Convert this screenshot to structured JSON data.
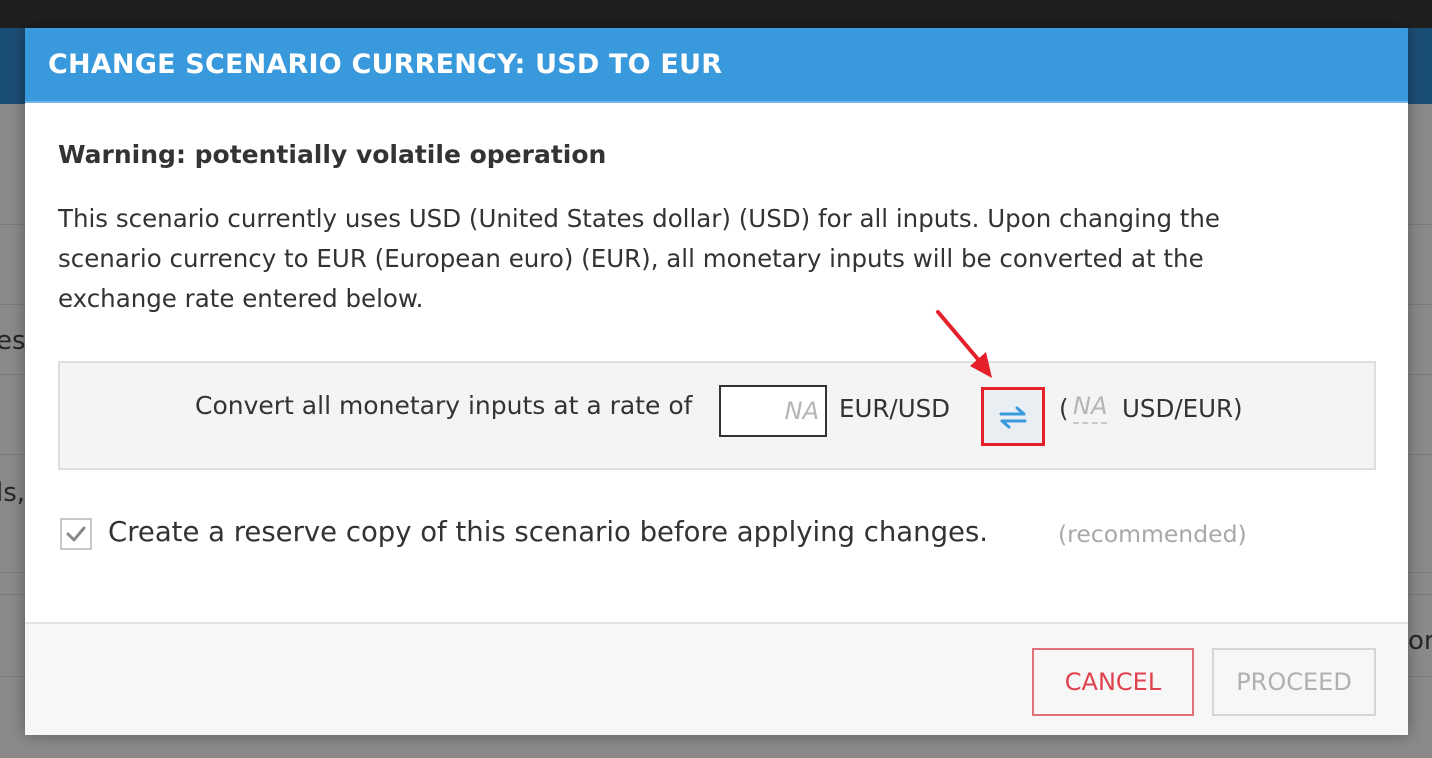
{
  "background": {
    "fragments": [
      "es",
      "ls,",
      "or"
    ]
  },
  "dialog": {
    "title": "CHANGE SCENARIO CURRENCY: USD TO EUR",
    "warning_title": "Warning: potentially volatile operation",
    "description": "This scenario currently uses USD (United States dollar) (USD) for all inputs. Upon changing the scenario currency to EUR (European euro) (EUR), all monetary inputs will be converted at the exchange rate entered below.",
    "rate": {
      "label": "Convert all monetary inputs at a rate of",
      "input_value": "",
      "input_placeholder": "NA",
      "unit": "EUR/USD",
      "swap_icon": "swap-arrows-icon",
      "paren_open": "(",
      "inverse_value": "NA",
      "inverse_unit": "USD/EUR)"
    },
    "reserve_copy": {
      "checked": true,
      "label": "Create a reserve copy of this scenario before applying changes.",
      "note": "(recommended)"
    },
    "buttons": {
      "cancel": "CANCEL",
      "proceed": "PROCEED"
    }
  },
  "colors": {
    "header": "#3899dc",
    "cancel": "#e0414d",
    "highlight": "#e5202b"
  }
}
